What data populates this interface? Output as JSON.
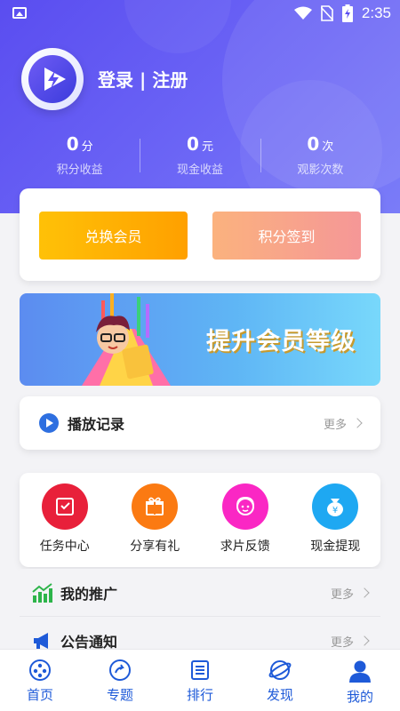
{
  "status": {
    "time": "2:35"
  },
  "profile": {
    "login_text": "登录 | 注册"
  },
  "stats": [
    {
      "num": "0",
      "unit": "分",
      "label": "积分收益"
    },
    {
      "num": "0",
      "unit": "元",
      "label": "现金收益"
    },
    {
      "num": "0",
      "unit": "次",
      "label": "观影次数"
    }
  ],
  "actions": {
    "exchange": "兑换会员",
    "checkin": "积分签到"
  },
  "banner": {
    "text": "提升会员等级"
  },
  "history": {
    "title": "播放记录",
    "more": "更多"
  },
  "grid": [
    {
      "label": "任务中心",
      "icon": "task-icon",
      "color": "#e8203a"
    },
    {
      "label": "分享有礼",
      "icon": "gift-icon",
      "color": "#fb7a12"
    },
    {
      "label": "求片反馈",
      "icon": "feedback-icon",
      "color": "#fa27c4"
    },
    {
      "label": "现金提现",
      "icon": "cash-bag-icon",
      "color": "#1ea8f2"
    }
  ],
  "rows": [
    {
      "title": "我的推广",
      "more": "更多"
    },
    {
      "title": "公告通知",
      "more": "更多"
    }
  ],
  "tabs": [
    {
      "label": "首页",
      "icon": "home-film-icon"
    },
    {
      "label": "专题",
      "icon": "topic-icon"
    },
    {
      "label": "排行",
      "icon": "rank-icon"
    },
    {
      "label": "发现",
      "icon": "discover-icon"
    },
    {
      "label": "我的",
      "icon": "profile-icon",
      "active": true
    }
  ],
  "colors": {
    "accent": "#1e5ad8",
    "header": "#5a4df0"
  }
}
